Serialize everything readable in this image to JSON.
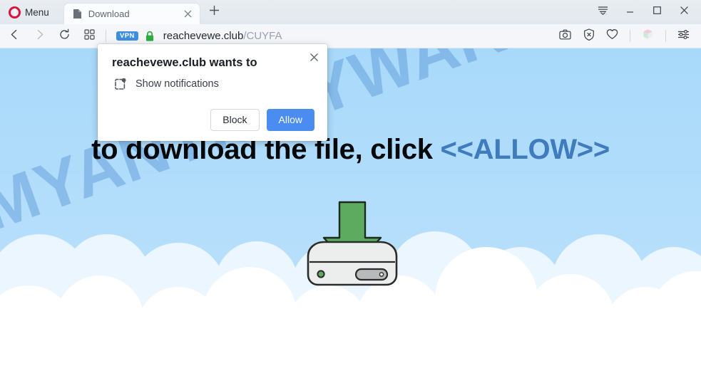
{
  "browser": {
    "menu_label": "Menu",
    "menu_icon": "opera-logo-icon",
    "tab": {
      "title": "Download",
      "favicon": "document-icon",
      "close_icon": "close-icon"
    },
    "new_tab_icon": "plus-icon",
    "window_controls": {
      "tab_menu_icon": "tab-list-icon",
      "minimize_icon": "minimize-icon",
      "maximize_icon": "maximize-icon",
      "close_icon": "close-icon"
    },
    "toolbar": {
      "back_icon": "back-arrow-icon",
      "forward_icon": "forward-arrow-icon",
      "reload_icon": "reload-icon",
      "speeddial_icon": "grid-icon",
      "vpn_badge": "VPN",
      "lock_icon": "lock-icon",
      "url_host": "reachevewe.club",
      "url_path": "/CUYFA",
      "right_icons": [
        "camera-icon",
        "adblock-shield-icon",
        "heart-icon",
        "extensions-cube-icon",
        "easy-setup-sliders-icon"
      ]
    }
  },
  "dialog": {
    "title": "reachevewe.club wants to",
    "permission_icon": "notification-bell-icon",
    "permission_text": "Show notifications",
    "close_icon": "close-icon",
    "block_label": "Block",
    "allow_label": "Allow",
    "allow_color": "#4a8cf0"
  },
  "page": {
    "headline_lead": "to download the file, click ",
    "headline_allow": "<<ALLOW>>",
    "headline_color": "#07080a",
    "allow_color": "#3f7cbd",
    "watermark": "MYANTISPYWARE.COM",
    "watermark_color": "#2f72c4",
    "sky_color": "#a9d9fa",
    "cloud_color": "#ffffff",
    "illustration": "hard-drive-download-icon",
    "arrow_color": "#56a55a"
  }
}
